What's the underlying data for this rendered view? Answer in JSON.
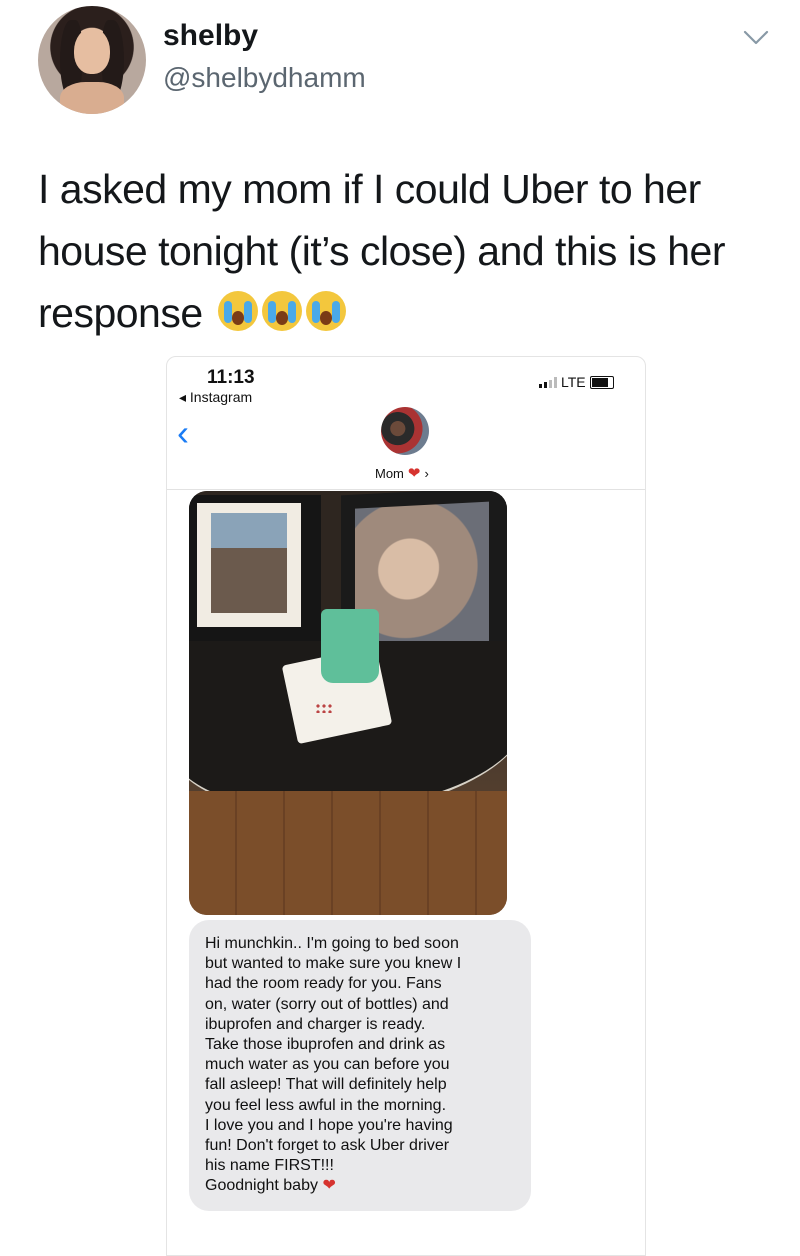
{
  "tweet": {
    "display_name": "shelby",
    "handle": "@shelbydhamm",
    "text": "I asked my mom if I could Uber to her house tonight (it’s close) and this is her response",
    "text_lines": [
      "I asked my mom if I could Uber to her",
      "house tonight (it’s close) and this is her",
      "response"
    ],
    "emoji_count": 3,
    "emoji_name": "loudly-crying-face-emoji"
  },
  "screenshot": {
    "status_time": "11:13",
    "back_app": "◂ Instagram",
    "network": "LTE",
    "contact_name": "Mom",
    "contact_chevron": "›",
    "heart": "❤",
    "message_lines": [
      "Hi munchkin.. I'm going to bed soon",
      "but wanted to make sure you knew I",
      "had the room ready for you. Fans",
      "on, water (sorry out of bottles) and",
      "ibuprofen and charger is ready.",
      "Take those ibuprofen and drink as",
      "much water as you can before you",
      "fall asleep! That will definitely help",
      "you feel less awful in the morning.",
      "I love you and I hope you're having",
      "fun! Don't forget to ask Uber driver",
      "his name FIRST!!!",
      "Goodnight baby"
    ]
  },
  "colors": {
    "ios_blue": "#1a7cf5",
    "bubble_grey": "#e9e9eb",
    "heart_red": "#d6332f",
    "handle_grey": "#5b6670"
  }
}
